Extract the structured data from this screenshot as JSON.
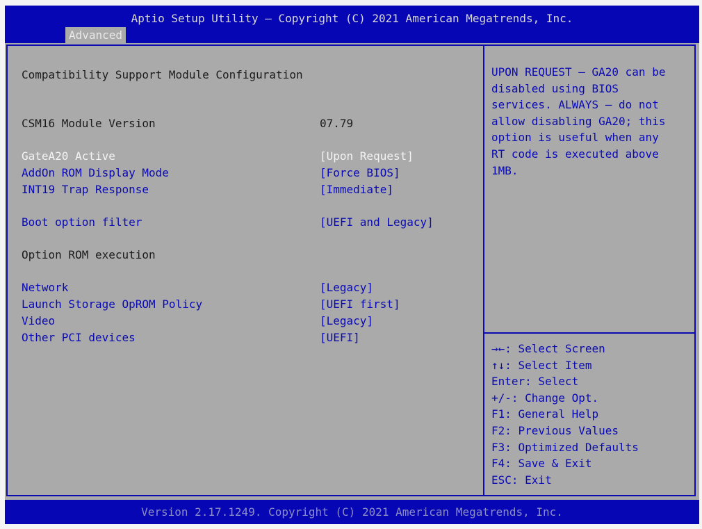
{
  "header": {
    "title": "Aptio Setup Utility – Copyright (C) 2021 American Megatrends, Inc.",
    "active_tab": "Advanced"
  },
  "main": {
    "section_title": "Compatibility Support Module Configuration",
    "module_version": {
      "label": "CSM16 Module Version",
      "value": "07.79"
    },
    "options": [
      {
        "label": "GateA20 Active",
        "value": "[Upon Request]",
        "selected": true
      },
      {
        "label": "AddOn ROM Display Mode",
        "value": "[Force BIOS]",
        "selected": false
      },
      {
        "label": "INT19 Trap Response",
        "value": "[Immediate]",
        "selected": false
      },
      {
        "label": "Boot option filter",
        "value": "[UEFI and Legacy]",
        "selected": false
      }
    ],
    "oprom_heading": "Option ROM execution",
    "oprom_options": [
      {
        "label": "Network",
        "value": "[Legacy]"
      },
      {
        "label": "Launch Storage OpROM Policy",
        "value": "[UEFI first]"
      },
      {
        "label": "Video",
        "value": "[Legacy]"
      },
      {
        "label": "Other PCI devices",
        "value": "[UEFI]"
      }
    ]
  },
  "help": {
    "lines": [
      "UPON REQUEST – GA20 can be",
      "disabled using BIOS",
      "services. ALWAYS – do not",
      "allow disabling GA20; this",
      "option is useful when any",
      "RT code is executed above",
      "1MB."
    ]
  },
  "keys": {
    "lines": [
      "→←: Select Screen",
      "↑↓: Select Item",
      "Enter: Select",
      "+/-: Change Opt.",
      "F1: General Help",
      "F2: Previous Values",
      "F3: Optimized Defaults",
      "F4: Save & Exit",
      "ESC: Exit"
    ]
  },
  "footer": {
    "text": "Version 2.17.1249. Copyright (C) 2021 American Megatrends, Inc."
  },
  "colors": {
    "header_blue": "#0606b4",
    "panel_gray": "#aaaaaa",
    "link_blue": "#0a0ab4",
    "selected_white": "#f4f4f4"
  }
}
